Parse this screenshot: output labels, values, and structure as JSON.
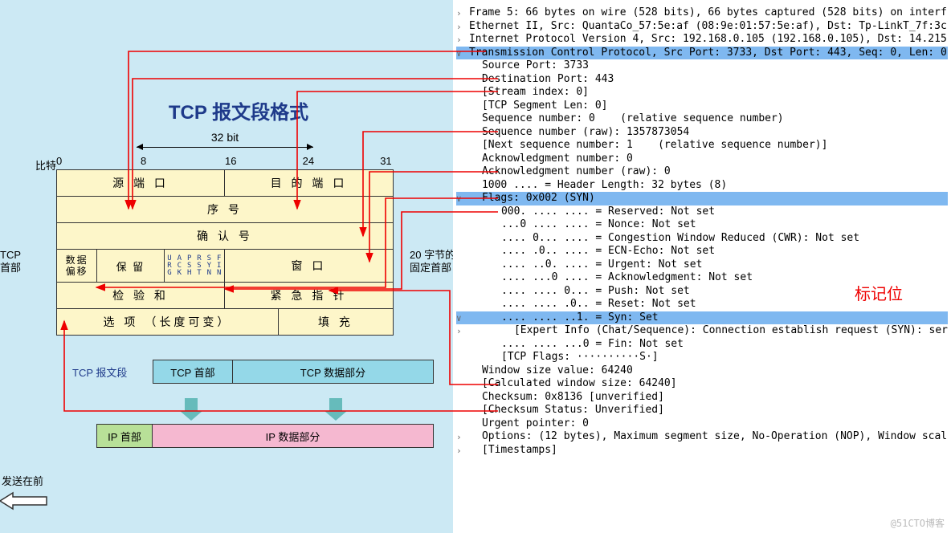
{
  "diagram": {
    "title": "TCP 报文段格式",
    "bit_width_label": "32 bit",
    "bit_prefix": "比特",
    "bit_scale": [
      "0",
      "8",
      "16",
      "24",
      "31"
    ],
    "tcp_header_side_label": "TCP\n首部",
    "fixed_header_side_label": "20 字节的\n固定首部",
    "rows": {
      "src_port": "源 端 口",
      "dst_port": "目 的 端 口",
      "seq": "序  号",
      "ack": "确 认 号",
      "data_offset_l1": "数据",
      "data_offset_l2": "偏移",
      "reserved": "保 留",
      "flags": [
        "U\nR\nG",
        "A\nC\nK",
        "P\nS\nH",
        "R\nS\nT",
        "S\nY\nN",
        "F\nI\nN"
      ],
      "window": "窗 口",
      "checksum": "检 验 和",
      "urgent": "紧 急 指 针",
      "options": "选 项  （长度可变）",
      "padding": "填  充"
    },
    "lower": {
      "tcp_segment_label": "TCP 报文段",
      "tcp_header_box": "TCP 首部",
      "tcp_data_box": "TCP 数据部分",
      "ip_header_box": "IP 首部",
      "ip_data_box": "IP 数据部分",
      "send_label": "发送在前"
    }
  },
  "packet": {
    "lines": [
      {
        "lv": 0,
        "c": "›",
        "t": "Frame 5: 66 bytes on wire (528 bits), 66 bytes captured (528 bits) on interf"
      },
      {
        "lv": 0,
        "c": "›",
        "t": "Ethernet II, Src: QuantaCo_57:5e:af (08:9e:01:57:5e:af), Dst: Tp-LinkT_7f:3c"
      },
      {
        "lv": 0,
        "c": "›",
        "t": "Internet Protocol Version 4, Src: 192.168.0.105 (192.168.0.105), Dst: 14.215"
      },
      {
        "lv": 0,
        "c": "∨",
        "hl": "blue",
        "t": "Transmission Control Protocol, Src Port: 3733, Dst Port: 443, Seq: 0, Len: 0"
      },
      {
        "lv": 1,
        "t": "Source Port: 3733"
      },
      {
        "lv": 1,
        "t": "Destination Port: 443"
      },
      {
        "lv": 1,
        "t": "[Stream index: 0]"
      },
      {
        "lv": 1,
        "t": "[TCP Segment Len: 0]"
      },
      {
        "lv": 1,
        "t": "Sequence number: 0    (relative sequence number)"
      },
      {
        "lv": 1,
        "t": "Sequence number (raw): 1357873054"
      },
      {
        "lv": 1,
        "t": "[Next sequence number: 1    (relative sequence number)]"
      },
      {
        "lv": 1,
        "t": "Acknowledgment number: 0"
      },
      {
        "lv": 1,
        "t": "Acknowledgment number (raw): 0"
      },
      {
        "lv": 1,
        "t": "1000 .... = Header Length: 32 bytes (8)"
      },
      {
        "lv": 1,
        "c": "∨",
        "hl": "blue",
        "t": "Flags: 0x002 (SYN)"
      },
      {
        "lv": 2,
        "t": "000. .... .... = Reserved: Not set"
      },
      {
        "lv": 2,
        "t": "...0 .... .... = Nonce: Not set"
      },
      {
        "lv": 2,
        "t": ".... 0... .... = Congestion Window Reduced (CWR): Not set"
      },
      {
        "lv": 2,
        "t": ".... .0.. .... = ECN-Echo: Not set"
      },
      {
        "lv": 2,
        "t": ".... ..0. .... = Urgent: Not set"
      },
      {
        "lv": 2,
        "t": ".... ...0 .... = Acknowledgment: Not set"
      },
      {
        "lv": 2,
        "t": ".... .... 0... = Push: Not set"
      },
      {
        "lv": 2,
        "t": ".... .... .0.. = Reset: Not set"
      },
      {
        "lv": 2,
        "c": "∨",
        "hl": "blue",
        "t": ".... .... ..1. = Syn: Set"
      },
      {
        "lv": 3,
        "c": "›",
        "t": "[Expert Info (Chat/Sequence): Connection establish request (SYN): ser"
      },
      {
        "lv": 2,
        "t": ".... .... ...0 = Fin: Not set"
      },
      {
        "lv": 2,
        "t": "[TCP Flags: ··········S·]"
      },
      {
        "lv": 1,
        "t": "Window size value: 64240"
      },
      {
        "lv": 1,
        "t": "[Calculated window size: 64240]"
      },
      {
        "lv": 1,
        "t": "Checksum: 0x8136 [unverified]"
      },
      {
        "lv": 1,
        "t": "[Checksum Status: Unverified]"
      },
      {
        "lv": 1,
        "t": "Urgent pointer: 0"
      },
      {
        "lv": 1,
        "c": "›",
        "t": "Options: (12 bytes), Maximum segment size, No-Operation (NOP), Window scal"
      },
      {
        "lv": 1,
        "c": "›",
        "t": "[Timestamps]"
      }
    ],
    "annotation_label": "标记位",
    "watermark": "@51CTO博客"
  }
}
